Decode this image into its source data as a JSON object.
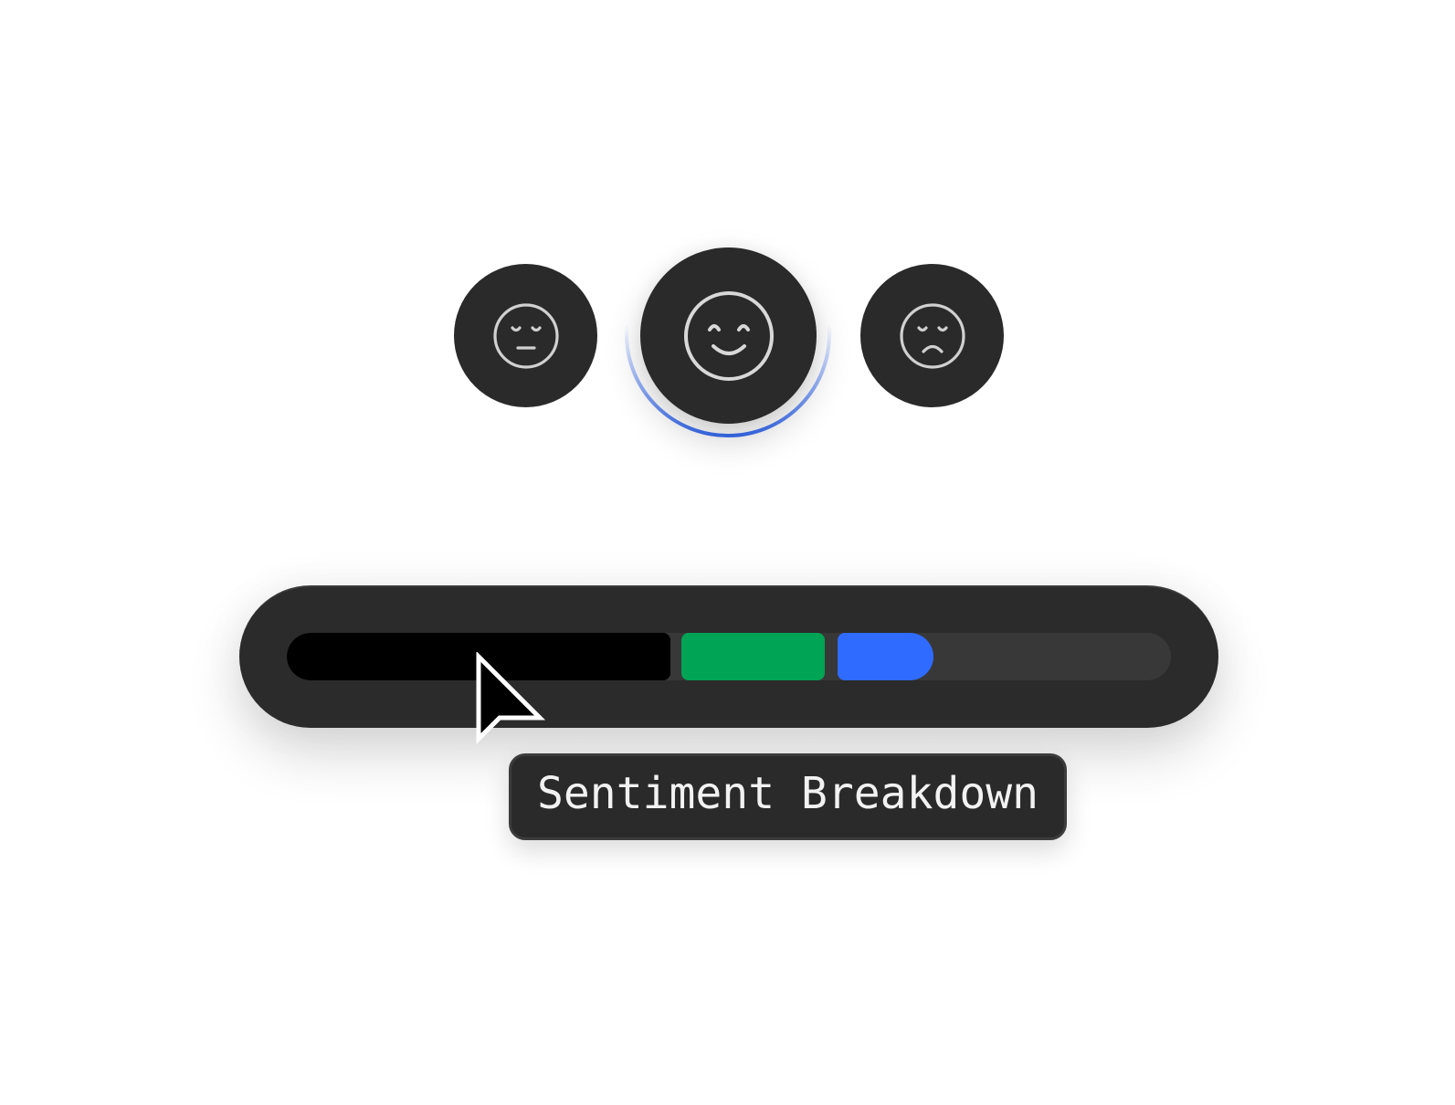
{
  "emoji_options": [
    {
      "name": "neutral-face",
      "selected": false
    },
    {
      "name": "smiling-face",
      "selected": true
    },
    {
      "name": "sad-face",
      "selected": false
    }
  ],
  "selection_color": "#3a6df0",
  "sentiment_bar": {
    "segments": [
      {
        "color": "#000000",
        "fraction": 0.43
      },
      {
        "color": "#00a455",
        "fraction": 0.16
      },
      {
        "color": "#2f6bff",
        "fraction": 0.11
      }
    ],
    "track_color": "#383838"
  },
  "tooltip": {
    "text": "Sentiment Breakdown"
  }
}
